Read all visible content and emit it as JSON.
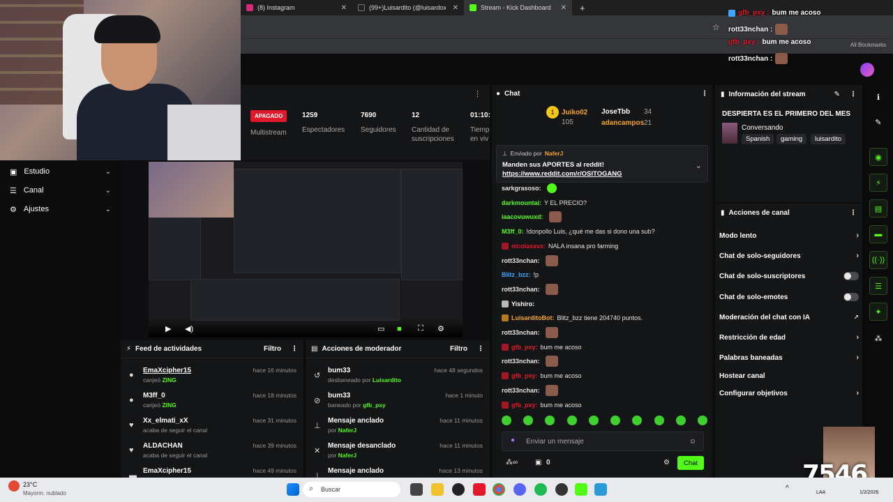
{
  "browser": {
    "tabs": [
      {
        "title": "(8) Instagram",
        "color": "#d62976"
      },
      {
        "title": "(99+)Luisardito (@luisardox) | T",
        "color": "#111111"
      },
      {
        "title": "Stream - Kick Dashboard",
        "color": "#53fc18"
      }
    ],
    "all_bookmarks": "All Bookmarks"
  },
  "overlay_chat": [
    {
      "user": "gfb_pxy :",
      "msg": "bum me acoso",
      "color": "#e3182b"
    },
    {
      "user": "rott33nchan :",
      "msg": "",
      "color": "#ffffff"
    },
    {
      "user": "gfb_pxy :",
      "msg": "bum me acoso",
      "color": "#e3182b"
    },
    {
      "user": "rott33nchan :",
      "msg": "",
      "color": "#ffffff"
    }
  ],
  "sidebar": {
    "items": [
      {
        "label": "Estudio"
      },
      {
        "label": "Canal"
      },
      {
        "label": "Ajustes"
      }
    ]
  },
  "stats": {
    "status": "APAGADO",
    "multistream": "Multistream",
    "viewers": {
      "value": "1259",
      "label": "Espectadores"
    },
    "followers": {
      "value": "7690",
      "label": "Seguidores"
    },
    "subs": {
      "value": "12",
      "label": "Cantidad de suscripciones"
    },
    "time": {
      "value": "01:10:",
      "label": "Tiemp en viv"
    }
  },
  "feed": {
    "title": "Feed de actividades",
    "filter": "Filtro",
    "rows": [
      {
        "name": "EmaXcipher15",
        "sub_pre": "canjeó",
        "sub_hl": "ZING",
        "time": "hace 16 minutos",
        "icon": "●"
      },
      {
        "name": "M3ff_0",
        "sub_pre": "canjeó",
        "sub_hl": "ZING",
        "time": "hace 18 minutos",
        "icon": "●"
      },
      {
        "name": "Xx_elmati_xX",
        "sub_pre": "acaba de seguir el canal",
        "sub_hl": "",
        "time": "hace 31 minutos",
        "icon": "♥"
      },
      {
        "name": "ALDACHAN",
        "sub_pre": "acaba de seguir el canal",
        "sub_hl": "",
        "time": "hace 39 minutos",
        "icon": "♥"
      },
      {
        "name": "EmaXcipher15",
        "sub_pre": "",
        "sub_hl": "",
        "time": "hace 49 minutos",
        "icon": "▬"
      }
    ]
  },
  "mod": {
    "title": "Acciones de moderador",
    "filter": "Filtro",
    "rows": [
      {
        "name": "bum33",
        "sub_pre": "desbaneado por",
        "sub_hl": "Luisardito",
        "time": "hace 48 segundos",
        "icon": "↺"
      },
      {
        "name": "bum33",
        "sub_pre": "baneado por",
        "sub_hl": "gfb_pxy",
        "time": "hace 1 minuto",
        "icon": "⊘"
      },
      {
        "name": "Mensaje anclado",
        "sub_pre": "por",
        "sub_hl": "NaferJ",
        "time": "hace 11 minutos",
        "icon": "📌"
      },
      {
        "name": "Mensaje desanclado",
        "sub_pre": "por",
        "sub_hl": "NaferJ",
        "time": "hace 11 minutos",
        "icon": "✕"
      },
      {
        "name": "Mensaje anclado",
        "sub_pre": "",
        "sub_hl": "",
        "time": "hace 13 minutos",
        "icon": "📌"
      }
    ]
  },
  "chat": {
    "title": "Chat",
    "top": [
      {
        "name": "Juiko02",
        "count": "105"
      },
      {
        "name": "JoseTbb",
        "count": "34"
      },
      {
        "name": "adancampos",
        "count": "21"
      }
    ],
    "pinned": {
      "sent_by": "Enviado por",
      "author": "NaferJ",
      "text": "Manden sus APORTES al reddit!",
      "link": "https://www.reddit.com/r/OSITOGANG"
    },
    "messages": [
      {
        "user": "sarkgrasoso:",
        "text": "",
        "color": "#e6e6e6",
        "emote": "green"
      },
      {
        "user": "darkmountai:",
        "text": "Y EL PRECIO?",
        "color": "#53fc18",
        "emote": ""
      },
      {
        "user": "iaacovuwuxd:",
        "text": "",
        "color": "#53fc18",
        "emote": "face"
      },
      {
        "user": "M3ff_0:",
        "text": "!donpollo Luis, ¿qué me das si dono una sub?",
        "color": "#53fc18",
        "emote": ""
      },
      {
        "user": "nicolasxvx:",
        "text": "NALA insana pro farming",
        "color": "#e3182b",
        "emote": ""
      },
      {
        "user": "rott33nchan:",
        "text": "",
        "color": "#e6e6e6",
        "emote": "face"
      },
      {
        "user": "Blitz_bzz:",
        "text": "!p",
        "color": "#3ea6ff",
        "emote": ""
      },
      {
        "user": "rott33nchan:",
        "text": "",
        "color": "#e6e6e6",
        "emote": "face"
      },
      {
        "user": "Yishiro:",
        "text": "",
        "color": "#ffffff",
        "emote": ""
      },
      {
        "user": "LuisarditoBot:",
        "text": "Blitz_bzz tiene 204740 puntos.",
        "color": "#f5a623",
        "emote": ""
      },
      {
        "user": "rott33nchan:",
        "text": "",
        "color": "#e6e6e6",
        "emote": "face"
      },
      {
        "user": "gfb_pxy:",
        "text": "bum me acoso",
        "color": "#e3182b",
        "emote": ""
      },
      {
        "user": "rott33nchan:",
        "text": "",
        "color": "#e6e6e6",
        "emote": "face"
      },
      {
        "user": "gfb_pxy:",
        "text": "bum me acoso",
        "color": "#e3182b",
        "emote": ""
      },
      {
        "user": "rott33nchan:",
        "text": "",
        "color": "#e6e6e6",
        "emote": "face"
      },
      {
        "user": "gfb_pxy:",
        "text": "bum me acoso",
        "color": "#e3182b",
        "emote": ""
      }
    ],
    "input_placeholder": "Enviar un mensaje",
    "points": "0",
    "send": "Chat"
  },
  "info": {
    "title": "Información del stream",
    "stream_title": "DESPIERTA ES EL PRIMERO DEL MES",
    "category": "Conversando",
    "tags": [
      "Spanish",
      "gaming",
      "luisardito"
    ]
  },
  "actions": {
    "title": "Acciones de canal",
    "items": [
      {
        "label": "Modo lento",
        "kind": "chev"
      },
      {
        "label": "Chat de solo-seguidores",
        "kind": "chev"
      },
      {
        "label": "Chat de solo-suscriptores",
        "kind": "toggle"
      },
      {
        "label": "Chat de solo-emotes",
        "kind": "toggle"
      },
      {
        "label": "Moderación del chat con IA",
        "kind": "ext"
      },
      {
        "label": "Restricción de edad",
        "kind": "chev"
      },
      {
        "label": "Palabras baneadas",
        "kind": "chev"
      },
      {
        "label": "Hostear canal",
        "kind": "none"
      },
      {
        "label": "Configurar objetivos",
        "kind": "chev"
      }
    ]
  },
  "overlay_number": "7546",
  "taskbar": {
    "weather_temp": "23°C",
    "weather_desc": "Mayorm. nublado",
    "search": "Buscar",
    "lang": "LAA",
    "date": "1/2/2026"
  }
}
